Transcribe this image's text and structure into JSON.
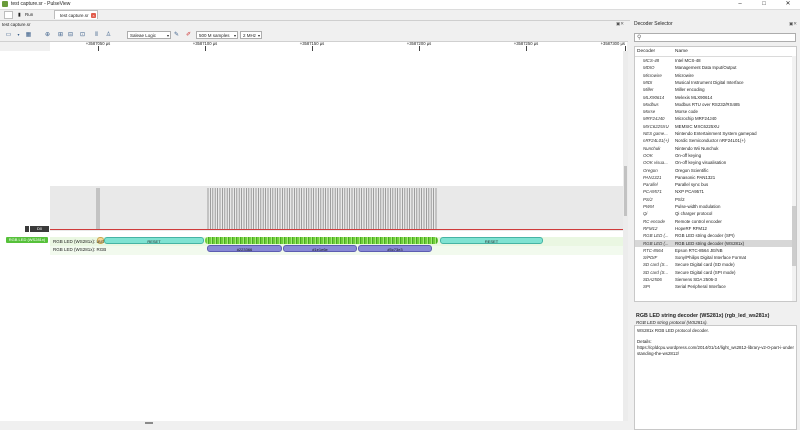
{
  "window": {
    "title": "test capture.sr - PulseView",
    "buttons": [
      "–",
      "□",
      "✕"
    ]
  },
  "session_bar": {
    "run_label": "Run",
    "tab_label": "test capture.sr",
    "session_name": "test capture.sr"
  },
  "toolbar": {
    "device_label": "Saleae Logic",
    "samples_label": "500 M samples",
    "rate_label": "2 MHz"
  },
  "ruler": {
    "ticks": [
      "+3587050 µs",
      "+3587100 µs",
      "+3587150 µs",
      "+3587200 µs",
      "+3587250 µs",
      "+3587300 µs"
    ]
  },
  "channels": {
    "d0_label": "D0",
    "decoder_label": "RGB LED (WS281x)",
    "row1_label": "RGB LED (WS281x): Bits",
    "row2_label": "RGB LED (WS281x): RGB"
  },
  "annotations": {
    "reset": "RESET",
    "small": "BIT",
    "colors": [
      "#223366",
      "#1e1e6e",
      "#5c73e3"
    ]
  },
  "decoder_selector": {
    "title": "Decoder Selector",
    "columns": [
      "Decoder",
      "Name"
    ],
    "rows": [
      [
        "MCS-48",
        "Intel MCS-48"
      ],
      [
        "MDIO",
        "Management Data Input/Output"
      ],
      [
        "Microwire",
        "Microwire"
      ],
      [
        "MIDI",
        "Musical Instrument Digital Interface"
      ],
      [
        "Miller",
        "Miller encoding"
      ],
      [
        "MLX90614",
        "Melexis MLX90614"
      ],
      [
        "Modbus",
        "Modbus RTU over RS232/RS485"
      ],
      [
        "Morse",
        "Morse code"
      ],
      [
        "MRF24J40",
        "Microchip MRF24J40"
      ],
      [
        "MXC6225XU",
        "MEMSIC MXC6225XU"
      ],
      [
        "NES game...",
        "Nintendo Entertainment System gamepad"
      ],
      [
        "nRF24L01(+)",
        "Nordic Semiconductor nRF24L01(+)"
      ],
      [
        "Nunchuk",
        "Nintendo Wii Nunchuk"
      ],
      [
        "OOK",
        "On-off keying"
      ],
      [
        "OOK visua...",
        "On-off keying visualisation"
      ],
      [
        "Oregon",
        "Oregon Scientific"
      ],
      [
        "PAN1321",
        "Panasonic PAN1321"
      ],
      [
        "Parallel",
        "Parallel sync bus"
      ],
      [
        "PCA9571",
        "NXP PCA9571"
      ],
      [
        "PS/2",
        "PS/2"
      ],
      [
        "PWM",
        "Pulse-width modulation"
      ],
      [
        "Qi",
        "Qi charger protocol"
      ],
      [
        "RC encode",
        "Remote control encoder"
      ],
      [
        "RFM12",
        "HopeRF RFM12"
      ],
      [
        "RGB LED (...",
        "RGB LED string decoder (SPI)"
      ],
      [
        "RGB LED (...",
        "RGB LED string decoder (WS281x)"
      ],
      [
        "RTC-8564",
        "Epson RTC-8564 JE/NB"
      ],
      [
        "S/PDIF",
        "Sony/Philips Digital Interface Format"
      ],
      [
        "SD card (S...",
        "Secure Digital card (SD mode)"
      ],
      [
        "SD card (S...",
        "Secure Digital card (SPI mode)"
      ],
      [
        "SDA2506",
        "Siemens SDA 2506-3"
      ],
      [
        "SPI",
        "Serial Peripheral Interface"
      ]
    ],
    "selected_index": 25,
    "info_name": "RGB LED string decoder (WS281x) (rgb_led_ws281x)",
    "info_sub": "RGB LED string protocol (WS281x).",
    "desc_line1": "WS281x RGB LED protocol decoder.",
    "desc_line2": "Details:",
    "desc_line3": "https://cpldcpu.wordpress.com/2014/01/14/light_ws2812-library-v2-0-part-i-understanding-the-ws2812/"
  }
}
